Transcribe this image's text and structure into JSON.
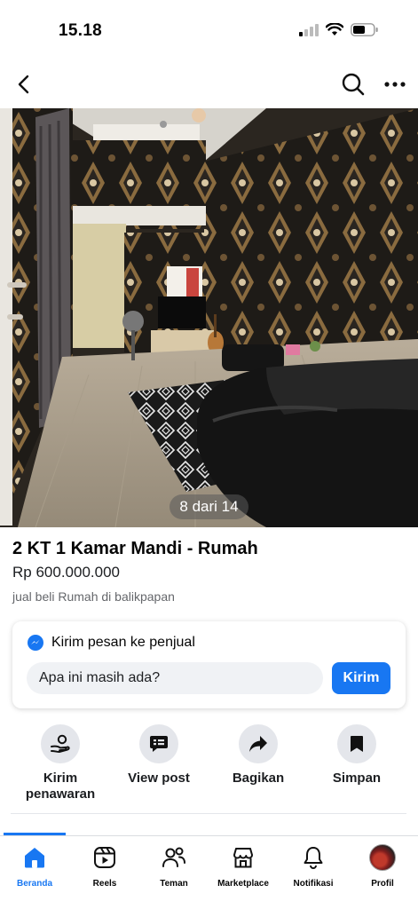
{
  "status": {
    "time": "15.18"
  },
  "photo": {
    "counter": "8 dari 14"
  },
  "listing": {
    "title": "2 KT 1 Kamar Mandi - Rumah",
    "price": "Rp 600.000.000",
    "meta": "jual beli Rumah di balikpapan"
  },
  "message": {
    "heading": "Kirim pesan ke penjual",
    "input_value": "Apa ini masih ada?",
    "send_label": "Kirim"
  },
  "actions": [
    {
      "label": "Kirim penawaran",
      "icon": "offer-icon"
    },
    {
      "label": "View post",
      "icon": "post-icon"
    },
    {
      "label": "Bagikan",
      "icon": "share-icon"
    },
    {
      "label": "Simpan",
      "icon": "bookmark-icon"
    }
  ],
  "tabs": [
    {
      "label": "Beranda",
      "icon": "home-icon",
      "active": true
    },
    {
      "label": "Reels",
      "icon": "reels-icon"
    },
    {
      "label": "Teman",
      "icon": "friends-icon"
    },
    {
      "label": "Marketplace",
      "icon": "marketplace-icon"
    },
    {
      "label": "Notifikasi",
      "icon": "bell-icon"
    },
    {
      "label": "Profil",
      "icon": "avatar"
    }
  ],
  "colors": {
    "accent": "#1877f2",
    "card_bg": "#e4e6eb",
    "muted_text": "#65676b"
  }
}
